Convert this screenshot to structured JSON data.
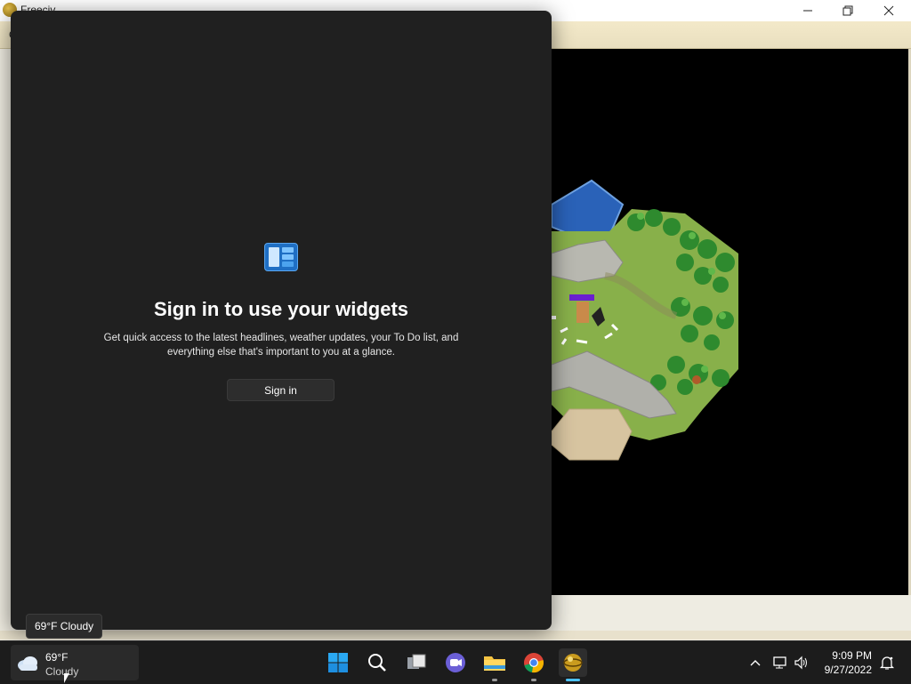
{
  "app": {
    "title": "Freeciv",
    "menu_first": "G"
  },
  "widgets": {
    "heading": "Sign in to use your widgets",
    "body": "Get quick access to the latest headlines, weather updates, your To Do list, and everything else that's important to you at a glance.",
    "signin_label": "Sign in"
  },
  "tooltip": {
    "text": "69°F Cloudy"
  },
  "taskbar": {
    "weather": {
      "temp": "69°F",
      "condition": "Cloudy"
    },
    "icons": [
      "windows-start-icon",
      "search-icon",
      "task-view-icon",
      "teams-chat-icon",
      "file-explorer-icon",
      "chrome-icon",
      "freeciv-icon"
    ],
    "clock": {
      "time": "9:09 PM",
      "date": "9/27/2022"
    }
  },
  "colors": {
    "panel_bg": "#202020",
    "taskbar_bg": "#1c1c1c",
    "accent": "#4cc2ff"
  }
}
